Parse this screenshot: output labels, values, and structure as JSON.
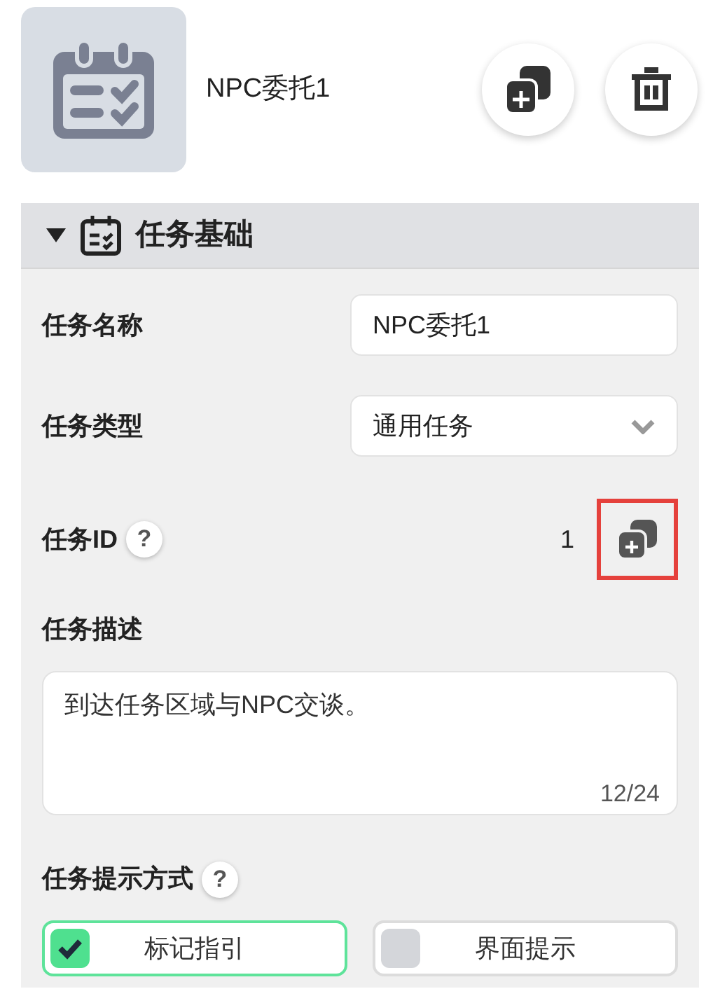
{
  "header": {
    "title": "NPC委托1"
  },
  "section": {
    "title": "任务基础",
    "expanded": true
  },
  "fields": [
    {
      "kind": "text",
      "label": "任务名称",
      "value": "NPC委托1"
    },
    {
      "kind": "select",
      "label": "任务类型",
      "value": "通用任务"
    },
    {
      "kind": "id",
      "label": "任务ID",
      "help": "?",
      "value": "1",
      "copy_highlighted": true
    },
    {
      "kind": "textarea",
      "label": "任务描述",
      "value": "到达任务区域与NPC交谈。",
      "counter": "12/24"
    },
    {
      "kind": "options",
      "label": "任务提示方式",
      "help": "?",
      "options": [
        {
          "label": "标记指引",
          "checked": true
        },
        {
          "label": "界面提示",
          "checked": false
        }
      ]
    }
  ]
}
